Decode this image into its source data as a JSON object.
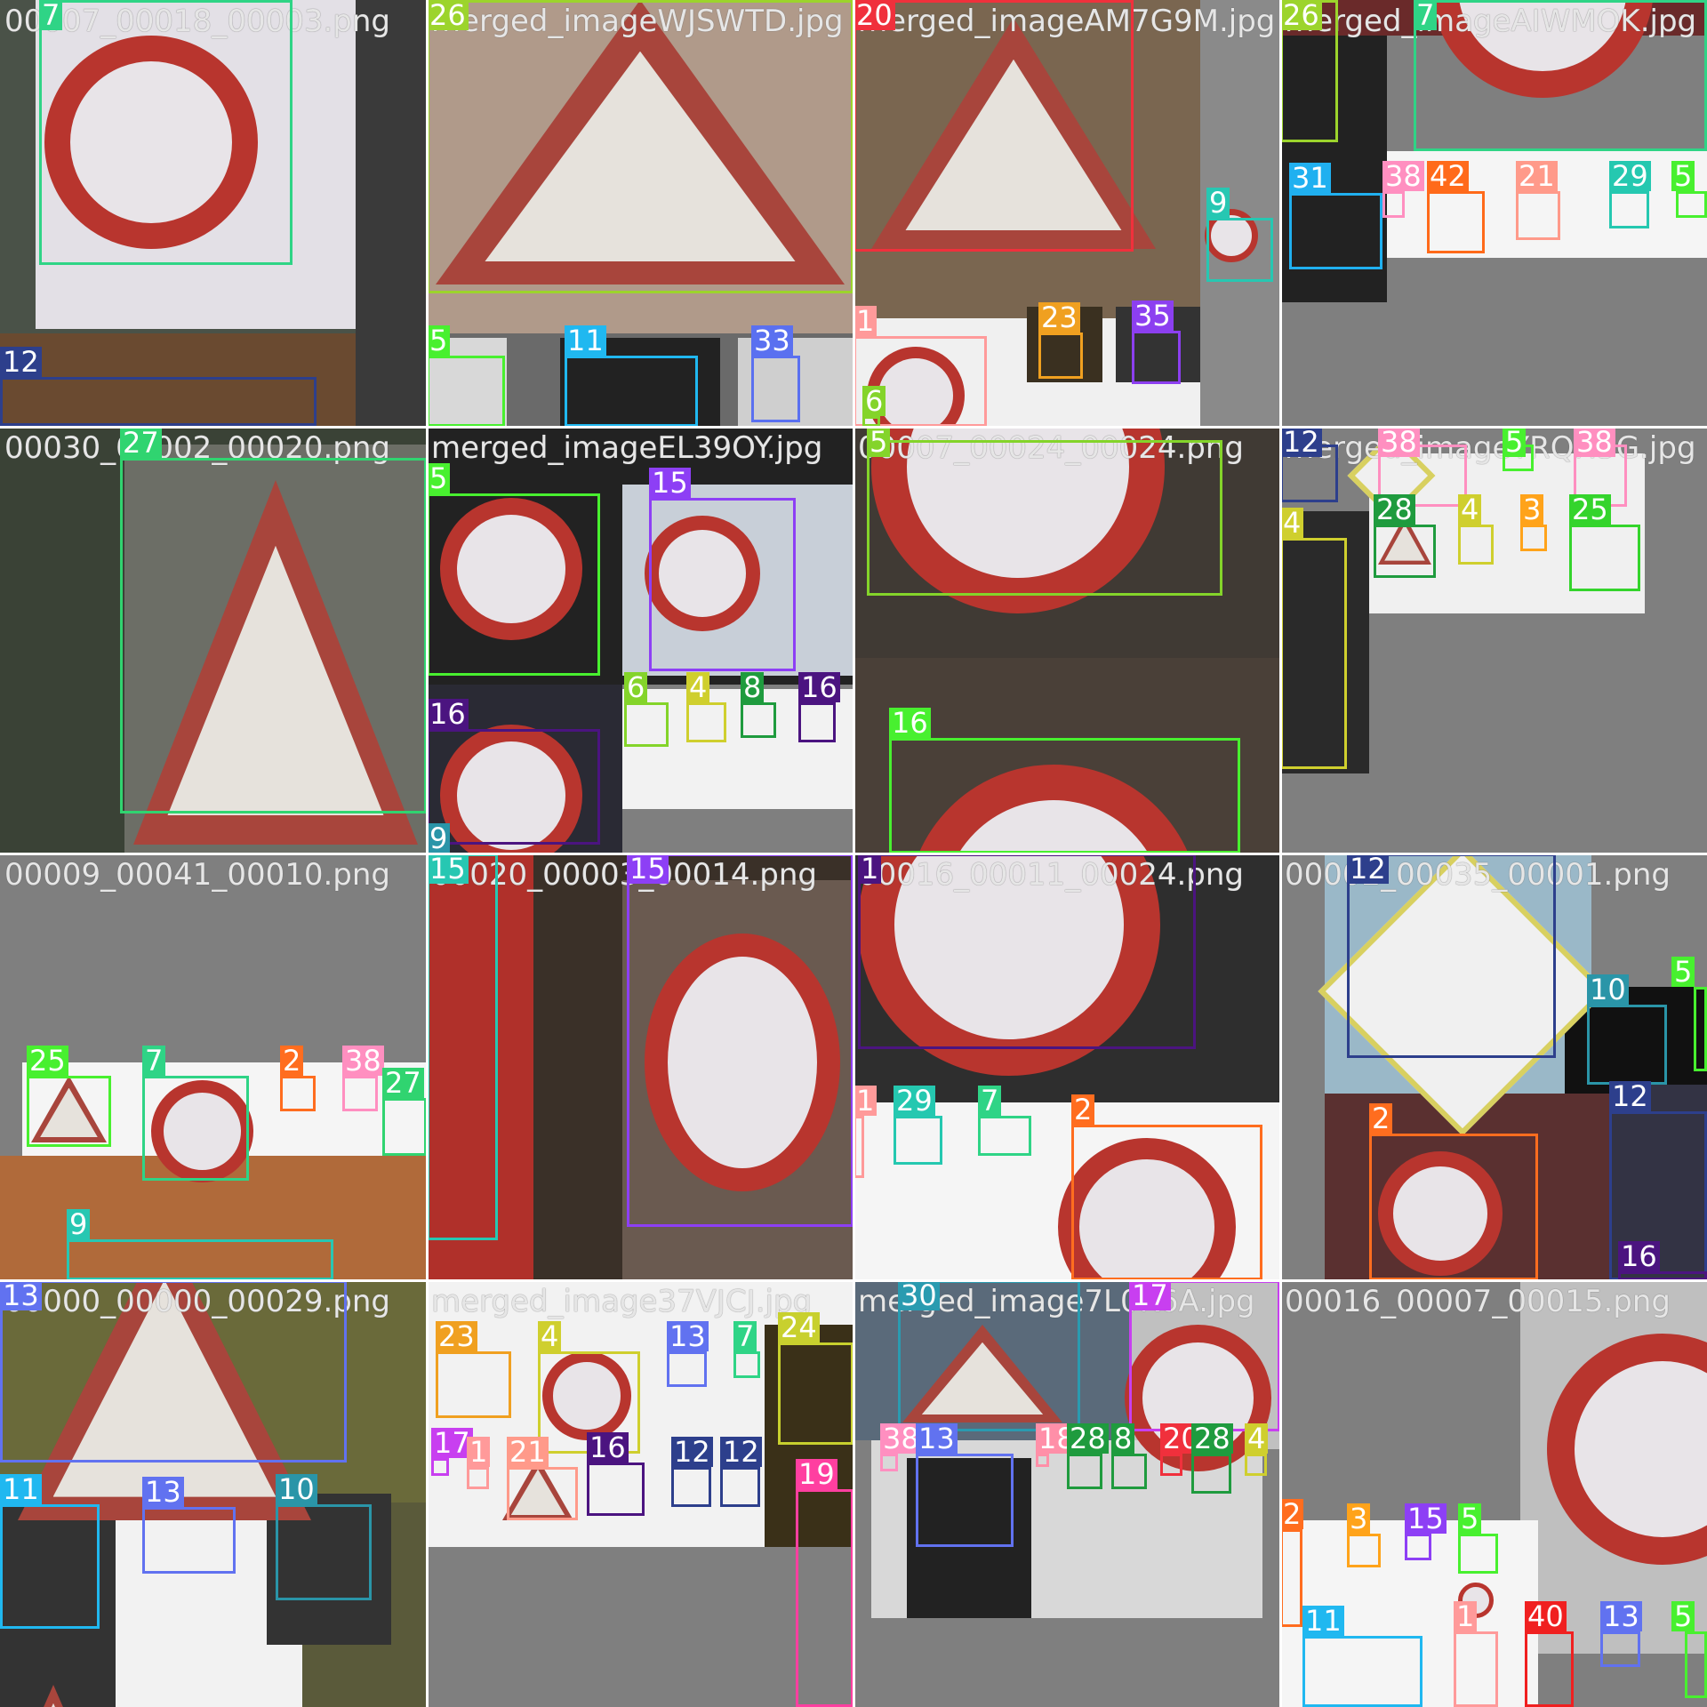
{
  "tiles": [
    {
      "filename": "00007_00018_00003.png",
      "bg": "#3b3f36",
      "labels": [
        "7",
        "12"
      ]
    },
    {
      "filename": "merged_imageWJSWTD.jpg",
      "bg": "#8a6b5d",
      "labels": [
        "26",
        "5",
        "11",
        "33"
      ]
    },
    {
      "filename": "merged_imageAM7G9M.jpg",
      "bg": "#6b5a45",
      "labels": [
        "20",
        "9",
        "1",
        "23",
        "35",
        "6"
      ]
    },
    {
      "filename": "merged_imageAIWMOK.jpg",
      "bg": "#7f7f7f",
      "labels": [
        "26",
        "7",
        "31",
        "38",
        "42",
        "21",
        "29",
        "5"
      ]
    },
    {
      "filename": "00030_00002_00020.png",
      "bg": "#2f3a33",
      "labels": [
        "27"
      ]
    },
    {
      "filename": "merged_imageEL39OY.jpg",
      "bg": "#7f7f7f",
      "labels": [
        "5",
        "15",
        "16",
        "6",
        "4",
        "8",
        "16",
        "9"
      ]
    },
    {
      "filename": "00007_00024_00024.png",
      "bg": "#3a3632",
      "labels": [
        "5",
        "16"
      ]
    },
    {
      "filename": "merged_imageYRQH5G.jpg",
      "bg": "#7f7f7f",
      "labels": [
        "12",
        "38",
        "5",
        "38",
        "28",
        "4",
        "3",
        "25",
        "4"
      ]
    },
    {
      "filename": "00009_00041_00010.png",
      "bg": "#7f7f7f",
      "labels": [
        "25",
        "7",
        "2",
        "38",
        "27",
        "9"
      ]
    },
    {
      "filename": "00020_00003_00014.png",
      "bg": "#2c2723",
      "labels": [
        "15"
      ]
    },
    {
      "filename": "00016_00011_00024.png",
      "bg": "#2d2d2d",
      "labels": [
        "1",
        "29",
        "7",
        "2"
      ]
    },
    {
      "filename": "00002_00035_00001.png",
      "bg": "#7f7f7f",
      "labels": [
        "12",
        "10",
        "5",
        "12",
        "2",
        "16"
      ]
    },
    {
      "filename": "00000_00000_00029.png",
      "bg": "#5a5a3a",
      "labels": [
        "13",
        "11",
        "13",
        "10"
      ]
    },
    {
      "filename": "merged_image37VJCJ.jpg",
      "bg": "#7f7f7f",
      "labels": [
        "23",
        "4",
        "13",
        "7",
        "24",
        "17",
        "1",
        "21",
        "16",
        "12",
        "12",
        "19"
      ]
    },
    {
      "filename": "merged_image7L0K6A.jpg",
      "bg": "#7f7f7f",
      "labels": [
        "30",
        "17",
        "38",
        "13",
        "18",
        "28",
        "8",
        "20",
        "28",
        "4"
      ]
    },
    {
      "filename": "00016_00007_00015.png",
      "bg": "#7f7f7f",
      "labels": [
        "2",
        "3",
        "15",
        "5",
        "11",
        "1",
        "40",
        "13",
        "5"
      ]
    }
  ],
  "colors": {
    "c1": "#ff9a9a",
    "c2": "#ff6d1f",
    "c3": "#ffa31a",
    "c4": "#cfcf2e",
    "c5": "#48f02f",
    "c6": "#84d42a",
    "c7": "#2fd486",
    "c8": "#1f9b3e",
    "c9": "#27c7b2",
    "c10": "#2a95a8",
    "c11": "#20b8f0",
    "c12": "#2d3f8c",
    "c13": "#6172f0",
    "c15": "#8d3ff5",
    "c16": "#4b1480",
    "c17": "#c83ff0",
    "c18": "#ff8fa8",
    "c19": "#ff3fa0",
    "c20": "#f0303c",
    "c21": "#ff9a8a",
    "c23": "#f0a020",
    "c24": "#c8d02e",
    "c25": "#34d42c",
    "c26": "#9cd42c",
    "c27": "#30d470",
    "c28": "#1f9b3e",
    "c29": "#25c8b0",
    "c30": "#2a9bb0",
    "c31": "#20b0f0",
    "c33": "#5a70f0",
    "c35": "#8c3ff0",
    "c38": "#ff8fc0",
    "c40": "#f02020",
    "c42": "#ff6a1a"
  }
}
